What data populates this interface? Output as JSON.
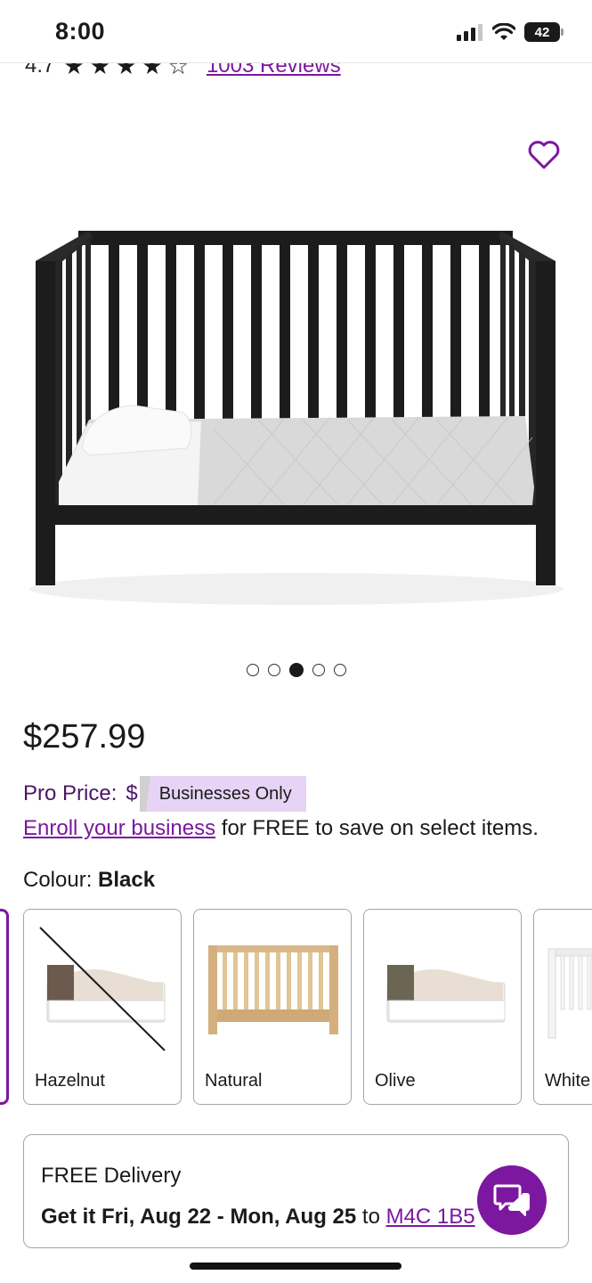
{
  "status": {
    "time": "8:00",
    "battery": "42"
  },
  "rating": {
    "value": "4.7",
    "reviews": "1003 Reviews"
  },
  "product": {
    "price": "$257.99",
    "pro_price_label": "Pro Price:",
    "pro_price_symbol": "$",
    "businesses_only": "Businesses Only",
    "enroll_link": "Enroll your business",
    "enroll_rest": " for FREE to save on select items.",
    "colour_label": "Colour: ",
    "colour_value": "Black"
  },
  "carousel": {
    "count": 5,
    "active_index": 2
  },
  "swatches": [
    {
      "label": "Hazelnut",
      "unavailable": true
    },
    {
      "label": "Natural",
      "unavailable": false
    },
    {
      "label": "Olive",
      "unavailable": false
    },
    {
      "label": "White",
      "unavailable": false
    }
  ],
  "delivery": {
    "title": "FREE Delivery",
    "date": "Get it Fri, Aug 22 - Mon, Aug 25",
    "to": " to ",
    "postal": "M4C 1B5"
  },
  "colors": {
    "accent": "#7b189f",
    "badge_bg": "#e7d3f5",
    "text": "#1a1a1a"
  },
  "icons": {
    "favorite": "heart-outline-icon",
    "chat": "chat-bubbles-icon"
  }
}
